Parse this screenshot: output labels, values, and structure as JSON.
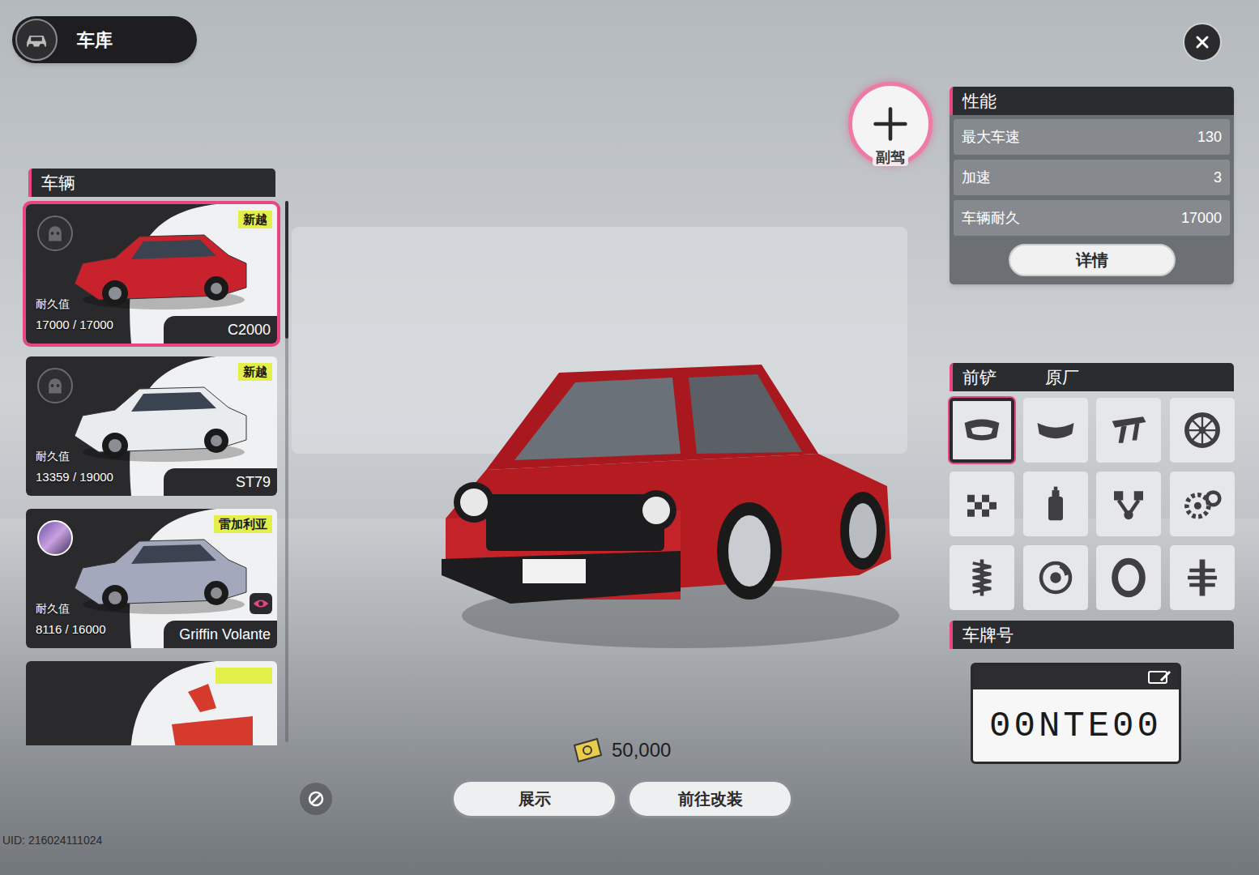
{
  "header": {
    "title": "车库"
  },
  "vehicle_list": {
    "title": "车辆",
    "items": [
      {
        "kind": "full",
        "name": "C2000",
        "tag": "新越",
        "durability_label": "耐久值",
        "durability": "17000 / 17000",
        "avatar": "empty",
        "watched": false,
        "selected": true,
        "color": "#c8232c"
      },
      {
        "kind": "full",
        "name": "ST79",
        "tag": "新越",
        "durability_label": "耐久值",
        "durability": "13359 / 19000",
        "avatar": "empty",
        "watched": false,
        "selected": false,
        "color": "#e9ecef"
      },
      {
        "kind": "full",
        "name": "Griffin Volante",
        "tag": "雷加利亚",
        "durability_label": "耐久值",
        "durability": "8116 / 16000",
        "avatar": "character",
        "watched": true,
        "selected": false,
        "color": "#a3a8bd"
      },
      {
        "kind": "clipped",
        "selected": false,
        "color": "#d63a2c"
      }
    ]
  },
  "co_driver": {
    "label": "副驾"
  },
  "performance": {
    "title": "性能",
    "stats": [
      {
        "label": "最大车速",
        "value": "130"
      },
      {
        "label": "加速",
        "value": "3"
      },
      {
        "label": "车辆耐久",
        "value": "17000"
      }
    ],
    "details_button": "详情"
  },
  "parts": {
    "title": "前铲",
    "value": "原厂",
    "slots": [
      {
        "kind": "front_bumper",
        "selected": true
      },
      {
        "kind": "rear_bumper",
        "selected": false
      },
      {
        "kind": "spoiler",
        "selected": false
      },
      {
        "kind": "wheel",
        "selected": false
      },
      {
        "kind": "livery",
        "selected": false
      },
      {
        "kind": "paint",
        "selected": false
      },
      {
        "kind": "engine",
        "selected": false
      },
      {
        "kind": "transmission",
        "selected": false
      },
      {
        "kind": "suspension",
        "selected": false
      },
      {
        "kind": "brake",
        "selected": false
      },
      {
        "kind": "tire",
        "selected": false
      },
      {
        "kind": "drivetrain",
        "selected": false
      }
    ]
  },
  "plate": {
    "title": "车牌号",
    "number": "00NTE00"
  },
  "currency": {
    "amount": "50,000"
  },
  "actions": [
    "展示",
    "前往改装"
  ],
  "uid": "UID: 216024111024"
}
